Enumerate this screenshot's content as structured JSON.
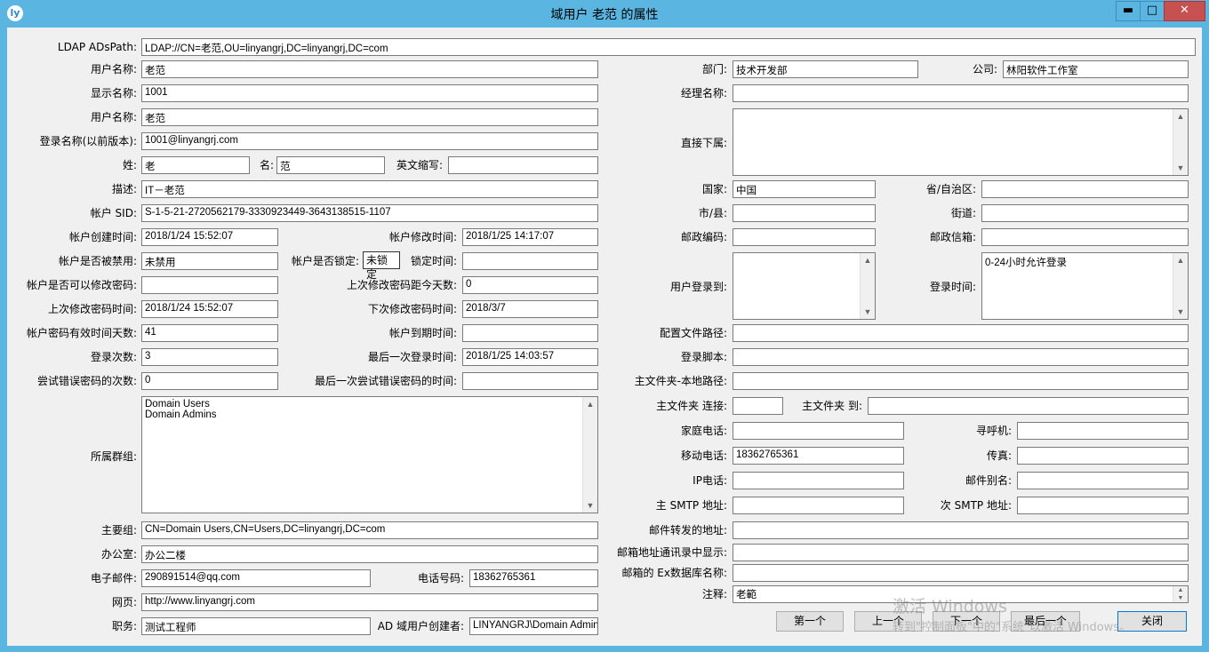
{
  "window": {
    "title": "域用户 老范 的属性",
    "icon_letter": "ly",
    "min_symbol": "▬",
    "max_symbol": "□",
    "close_symbol": "✕"
  },
  "left": {
    "ldap_label": "LDAP ADsPath:",
    "ldap_value": "LDAP://CN=老范,OU=linyangrj,DC=linyangrj,DC=com",
    "username_label": "用户名称:",
    "username_value": "老范",
    "display_label": "显示名称:",
    "display_value": "1001",
    "username2_label": "用户名称:",
    "username2_value": "老范",
    "prewin_label": "登录名称(以前版本):",
    "prewin_value": "1001@linyangrj.com",
    "surname_label": "姓:",
    "surname_value": "老",
    "given_label": "名:",
    "given_value": "范",
    "initials_label": "英文缩写:",
    "initials_value": "",
    "desc_label": "描述:",
    "desc_value": "IT－老范",
    "sid_label": "帐户 SID:",
    "sid_value": "S-1-5-21-2720562179-3330923449-3643138515-1107",
    "created_label": "帐户创建时间:",
    "created_value": "2018/1/24 15:52:07",
    "modified_label": "帐户修改时间:",
    "modified_value": "2018/1/25 14:17:07",
    "disabled_label": "帐户是否被禁用:",
    "disabled_value": "未禁用",
    "locked_label": "帐户是否锁定:",
    "locked_value": "未锁定",
    "locktime_label": "锁定时间:",
    "locktime_value": "",
    "canchange_label": "帐户是否可以修改密码:",
    "canchange_value": "",
    "dayssince_label": "上次修改密码距今天数:",
    "dayssince_value": "0",
    "lastpwd_label": "上次修改密码时间:",
    "lastpwd_value": "2018/1/24 15:52:07",
    "nextpwd_label": "下次修改密码时间:",
    "nextpwd_value": "2018/3/7",
    "pwddays_label": "帐户密码有效时间天数:",
    "pwddays_value": "41",
    "expires_label": "帐户到期时间:",
    "expires_value": "",
    "logincount_label": "登录次数:",
    "logincount_value": "3",
    "lastlogin_label": "最后一次登录时间:",
    "lastlogin_value": "2018/1/25 14:03:57",
    "badpwd_label": "尝试错误密码的次数:",
    "badpwd_value": "0",
    "lastbad_label": "最后一次尝试错误密码的时间:",
    "lastbad_value": "",
    "groups_label": "所属群组:",
    "groups": [
      "Domain Users",
      "Domain Admins"
    ],
    "primary_label": "主要组:",
    "primary_value": "CN=Domain Users,CN=Users,DC=linyangrj,DC=com",
    "office_label": "办公室:",
    "office_value": "办公二楼",
    "email_label": "电子邮件:",
    "email_value": "290891514@qq.com",
    "phone_label": "电话号码:",
    "phone_value": "18362765361",
    "web_label": "网页:",
    "web_value": "http://www.linyangrj.com",
    "title_label": "职务:",
    "title_value": "测试工程师",
    "creator_label": "AD 域用户创建者:",
    "creator_value": "LINYANGRJ\\Domain Admins"
  },
  "right": {
    "dept_label": "部门:",
    "dept_value": "技术开发部",
    "company_label": "公司:",
    "company_value": "林阳软件工作室",
    "manager_label": "经理名称:",
    "manager_value": "",
    "reports_label": "直接下属:",
    "reports_value": "",
    "country_label": "国家:",
    "country_value": "中国",
    "province_label": "省/自治区:",
    "province_value": "",
    "city_label": "市/县:",
    "city_value": "",
    "street_label": "街道:",
    "street_value": "",
    "zip_label": "邮政编码:",
    "zip_value": "",
    "pobox_label": "邮政信箱:",
    "pobox_value": "",
    "logonto_label": "用户登录到:",
    "logonto_value": "",
    "logonhours_label": "登录时间:",
    "logonhours_value": "0-24小时允许登录",
    "profile_label": "配置文件路径:",
    "profile_value": "",
    "script_label": "登录脚本:",
    "script_value": "",
    "homelocal_label": "主文件夹-本地路径:",
    "homelocal_value": "",
    "homeconn_label": "主文件夹 连接:",
    "homeconn_value": "",
    "hometo_label": "主文件夹 到:",
    "hometo_value": "",
    "homephone_label": "家庭电话:",
    "homephone_value": "",
    "pager_label": "寻呼机:",
    "pager_value": "",
    "mobile_label": "移动电话:",
    "mobile_value": "18362765361",
    "fax_label": "传真:",
    "fax_value": "",
    "ipphone_label": "IP电话:",
    "ipphone_value": "",
    "alias_label": "邮件别名:",
    "alias_value": "",
    "smtp1_label": "主 SMTP 地址:",
    "smtp1_value": "",
    "smtp2_label": "次 SMTP 地址:",
    "smtp2_value": "",
    "forward_label": "邮件转发的地址:",
    "forward_value": "",
    "gal_label": "邮箱地址通讯录中显示:",
    "gal_value": "",
    "exdb_label": "邮箱的 Ex数据库名称:",
    "exdb_value": "",
    "notes_label": "注释:",
    "notes_value": "老範"
  },
  "buttons": {
    "first": "第一个",
    "prev": "上一个",
    "next": "下一个",
    "last": "最后一个",
    "close": "关闭"
  },
  "watermark": {
    "line1": "激活 Windows",
    "line2": "转到\"控制面板\"中的\"系统\"以激活 Windows。"
  },
  "scroll": {
    "up": "▲",
    "down": "▼"
  }
}
